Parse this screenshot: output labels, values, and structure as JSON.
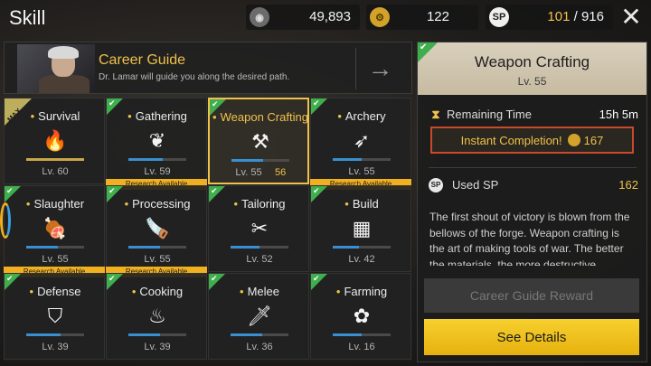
{
  "window": {
    "title": "Skill"
  },
  "resources": [
    {
      "icon": "compass-icon",
      "value": "49,893"
    },
    {
      "icon": "gear-coin-icon",
      "value": "122"
    },
    {
      "icon": "sp-icon",
      "value_used": "101",
      "separator": " / ",
      "value_total": "916",
      "icon_text": "SP"
    }
  ],
  "career_guide": {
    "title": "Career Guide",
    "description": "Dr. Lamar will guide you along the desired path.",
    "arrow": "→"
  },
  "skills": [
    {
      "name": "Survival",
      "level": "Lv. 60",
      "icon": "campfire-icon",
      "glyph": "🔥",
      "progress": 1.0,
      "badge": "MAX"
    },
    {
      "name": "Gathering",
      "level": "Lv. 59",
      "icon": "leaves-icon",
      "glyph": "❦",
      "progress": 0.6,
      "research": "Research Available"
    },
    {
      "name": "Weapon Crafting",
      "level": "Lv. 55",
      "next_level": "56",
      "icon": "anvil-icon",
      "glyph": "⚒",
      "progress": 0.55,
      "selected": true
    },
    {
      "name": "Archery",
      "level": "Lv. 55",
      "icon": "bow-icon",
      "glyph": "➶",
      "progress": 0.5,
      "research": "Research Available"
    },
    {
      "name": "Slaughter",
      "level": "Lv. 55",
      "icon": "meat-icon",
      "glyph": "🍖",
      "progress": 0.55,
      "research": "Research Available"
    },
    {
      "name": "Processing",
      "level": "Lv. 55",
      "icon": "saw-icon",
      "glyph": "🪚",
      "progress": 0.55,
      "research": "Research Available"
    },
    {
      "name": "Tailoring",
      "level": "Lv. 52",
      "icon": "scissors-icon",
      "glyph": "✂",
      "progress": 0.5
    },
    {
      "name": "Build",
      "level": "Lv. 42",
      "icon": "bricks-icon",
      "glyph": "▦",
      "progress": 0.45
    },
    {
      "name": "Defense",
      "level": "Lv. 39",
      "icon": "shield-icon",
      "glyph": "⛉",
      "progress": 0.6
    },
    {
      "name": "Cooking",
      "level": "Lv. 39",
      "icon": "grill-icon",
      "glyph": "♨",
      "progress": 0.55
    },
    {
      "name": "Melee",
      "level": "Lv. 36",
      "icon": "knife-icon",
      "glyph": "🗡",
      "progress": 0.55
    },
    {
      "name": "Farming",
      "level": "Lv. 16",
      "icon": "plant-icon",
      "glyph": "✿",
      "progress": 0.5
    }
  ],
  "detail": {
    "title": "Weapon Crafting",
    "level": "Lv. 55",
    "remaining_label": "Remaining Time",
    "remaining_value": "15h 5m",
    "instant_label": "Instant Completion!",
    "instant_cost": "167",
    "used_sp_label": "Used SP",
    "used_sp_value": "162",
    "sp_icon_text": "SP",
    "description": "The first shout of victory is blown from the bellows of the forge. Weapon crafting is the art of making tools of war. The better the materials, the more destructive",
    "career_guide_reward": "Career Guide Reward",
    "see_details": "See Details"
  },
  "colors": {
    "accent": "#f0c14b",
    "check": "#3fae4d",
    "progress": "#3a8fd1",
    "research": "#f0b020",
    "instant_border": "#c94a2b"
  }
}
